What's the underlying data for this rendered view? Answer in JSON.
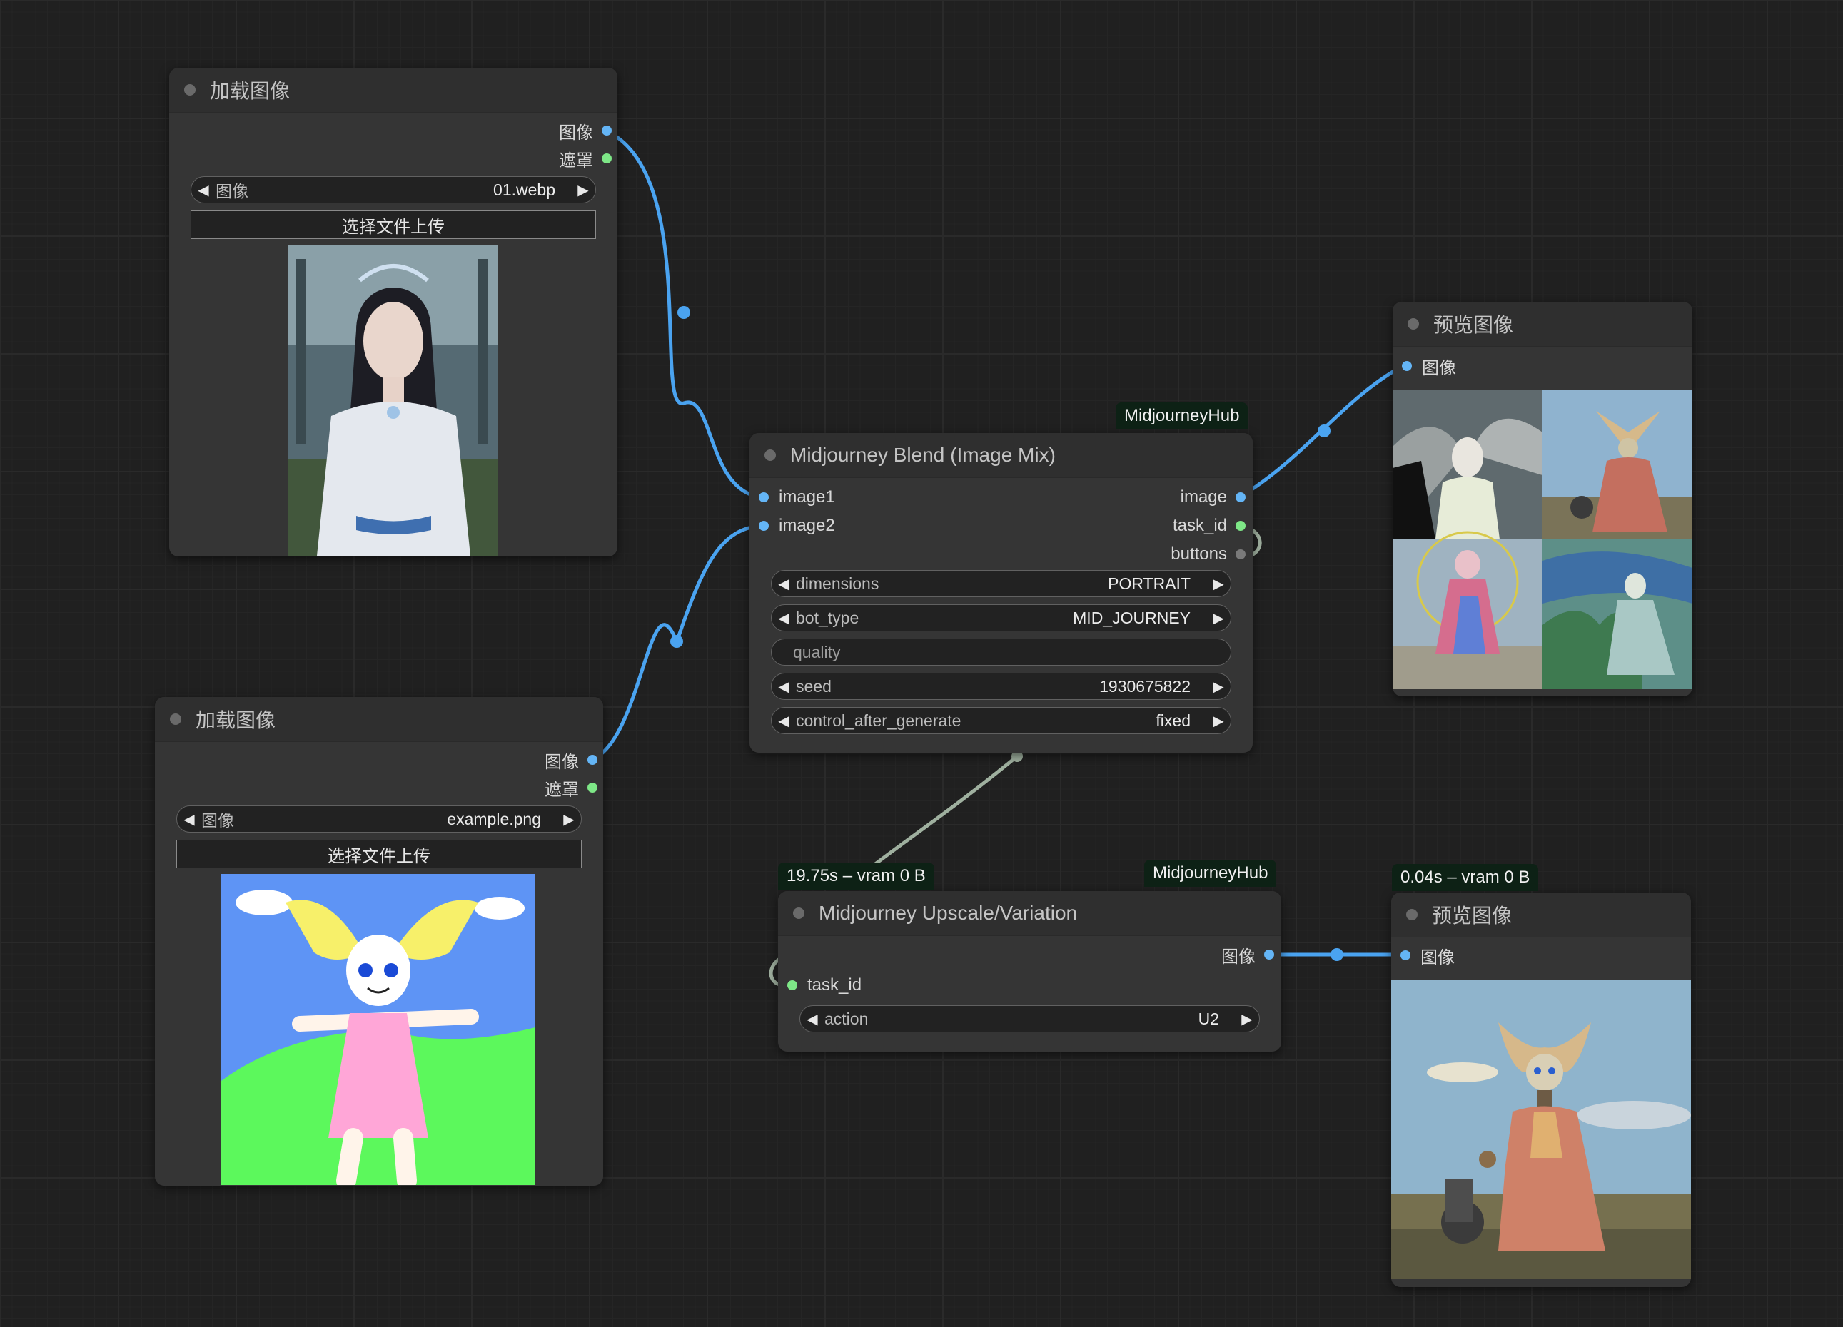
{
  "nodes": {
    "load1": {
      "title": "加载图像",
      "outputs": [
        "图像",
        "遮罩"
      ],
      "image_widget": {
        "label": "图像",
        "value": "01.webp"
      },
      "upload_label": "选择文件上传"
    },
    "load2": {
      "title": "加载图像",
      "outputs": [
        "图像",
        "遮罩"
      ],
      "image_widget": {
        "label": "图像",
        "value": "example.png"
      },
      "upload_label": "选择文件上传"
    },
    "blend": {
      "badge": "MidjourneyHub",
      "title": "Midjourney Blend (Image Mix)",
      "inputs": [
        "image1",
        "image2"
      ],
      "outputs": [
        "image",
        "task_id",
        "buttons"
      ],
      "widgets": [
        {
          "label": "dimensions",
          "value": "PORTRAIT"
        },
        {
          "label": "bot_type",
          "value": "MID_JOURNEY"
        },
        {
          "label": "quality",
          "value": ""
        },
        {
          "label": "seed",
          "value": "1930675822"
        },
        {
          "label": "control_after_generate",
          "value": "fixed"
        }
      ]
    },
    "preview1": {
      "title": "预览图像",
      "input": "图像"
    },
    "upscale": {
      "badge_left": "19.75s – vram 0 B",
      "badge_right": "MidjourneyHub",
      "title": "Midjourney Upscale/Variation",
      "output": "图像",
      "input": "task_id",
      "widget": {
        "label": "action",
        "value": "U2"
      }
    },
    "preview2": {
      "badge": "0.04s – vram 0 B",
      "title": "预览图像",
      "input": "图像"
    }
  },
  "colors": {
    "link_image": "#4aa3f0",
    "link_task": "#9fb09f",
    "slot_image": "#64b5f6",
    "slot_mask": "#7ee787",
    "canvas": "#202020",
    "node": "#353535"
  }
}
